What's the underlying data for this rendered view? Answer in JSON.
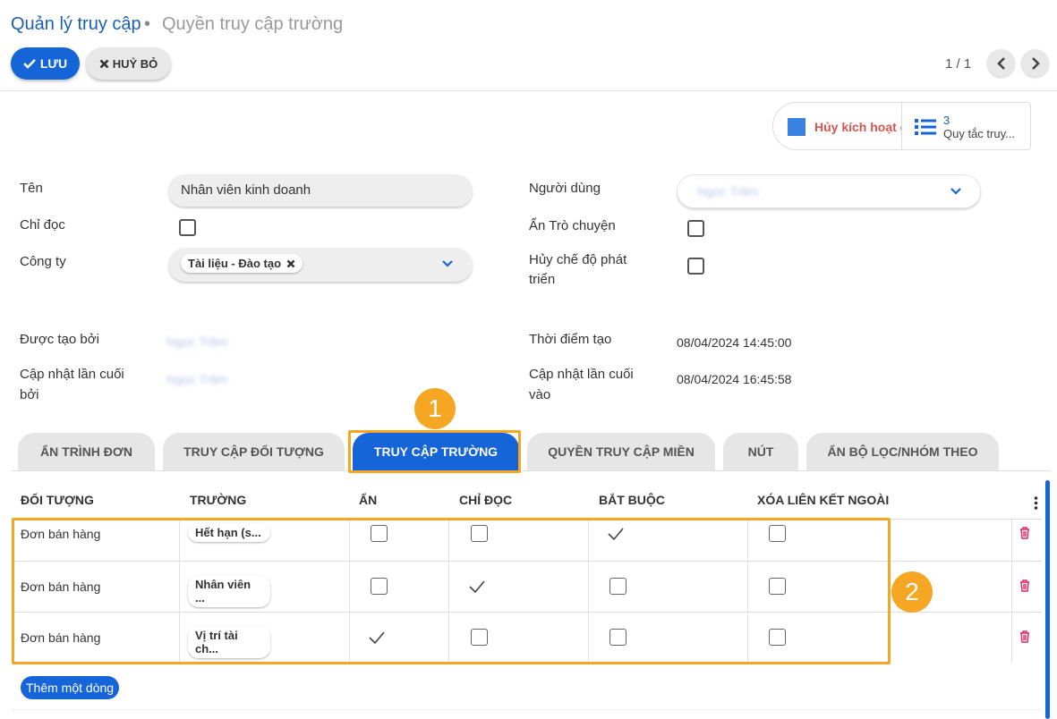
{
  "breadcrumb": {
    "parent": "Quản lý truy cập",
    "separator": "•",
    "current": "Quyền truy cập trường"
  },
  "toolbar": {
    "save_label": "LƯU",
    "cancel_label": "HUỶ BỎ",
    "pager": "1 / 1"
  },
  "smart_buttons": {
    "deactivate_label": "Hủy kích hoạt quyền",
    "rules_count": "3",
    "rules_label": "Quy tắc truy..."
  },
  "form": {
    "name_label": "Tên",
    "name_value": "Nhân viên kinh doanh",
    "readonly_label": "Chỉ đọc",
    "company_label": "Công ty",
    "company_tag": "Tài liệu - Đào tạo",
    "user_label": "Người dùng",
    "user_value": "Ngọc Trâm",
    "hide_chat_label": "Ẩn Trò chuyện",
    "disable_dev_label": "Hủy chế độ phát triển",
    "created_by_label": "Được tạo bởi",
    "created_by_value": "Ngọc Trâm",
    "updated_by_label": "Cập nhật lần cuối bởi",
    "updated_by_value": "Ngọc Trâm",
    "created_at_label": "Thời điểm tạo",
    "created_at_value": "08/04/2024 14:45:00",
    "updated_at_label": "Cập nhật lần cuối vào",
    "updated_at_value": "08/04/2024 16:45:58"
  },
  "tabs": [
    {
      "label": "ẨN TRÌNH ĐƠN"
    },
    {
      "label": "TRUY CẬP ĐỐI TƯỢNG"
    },
    {
      "label": "TRUY CẬP TRƯỜNG"
    },
    {
      "label": "QUYỀN TRUY CẬP MIỀN"
    },
    {
      "label": "NÚT"
    },
    {
      "label": "ẨN BỘ LỌC/NHÓM THEO"
    }
  ],
  "table": {
    "columns": [
      "ĐỐI TƯỢNG",
      "TRƯỜNG",
      "ẨN",
      "CHỈ ĐỌC",
      "BẮT BUỘC",
      "XÓA LIÊN KẾT NGOÀI"
    ],
    "rows": [
      {
        "object": "Đơn bán hàng",
        "field": "Hết hạn (s...",
        "hidden": false,
        "readonly": false,
        "required": true,
        "remove_link": false
      },
      {
        "object": "Đơn bán hàng",
        "field": "Nhân viên ...",
        "hidden": false,
        "readonly": true,
        "required": false,
        "remove_link": false
      },
      {
        "object": "Đơn bán hàng",
        "field": "Vị trí tài ch...",
        "hidden": true,
        "readonly": false,
        "required": false,
        "remove_link": false
      }
    ],
    "add_line_label": "Thêm một dòng"
  },
  "annotations": {
    "badge_1": "1",
    "badge_2": "2"
  },
  "colors": {
    "primary": "#1565d8",
    "highlight": "#f5a623",
    "danger": "#d9534f"
  }
}
